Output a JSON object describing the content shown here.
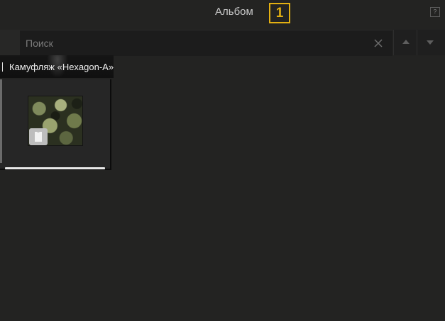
{
  "window": {
    "title": "Альбом",
    "badge_number": "1",
    "help_label": "?"
  },
  "search": {
    "placeholder": "Поиск",
    "value": ""
  },
  "group": {
    "title": "Камуфляж «Hexagon-A»"
  },
  "items": [
    {
      "icon": "hexagon-camouflage-thumbnail",
      "badge_icon": "shirt-icon"
    }
  ],
  "colors": {
    "background": "#232322",
    "accent": "#e3b012",
    "text": "#c9c9c9"
  }
}
